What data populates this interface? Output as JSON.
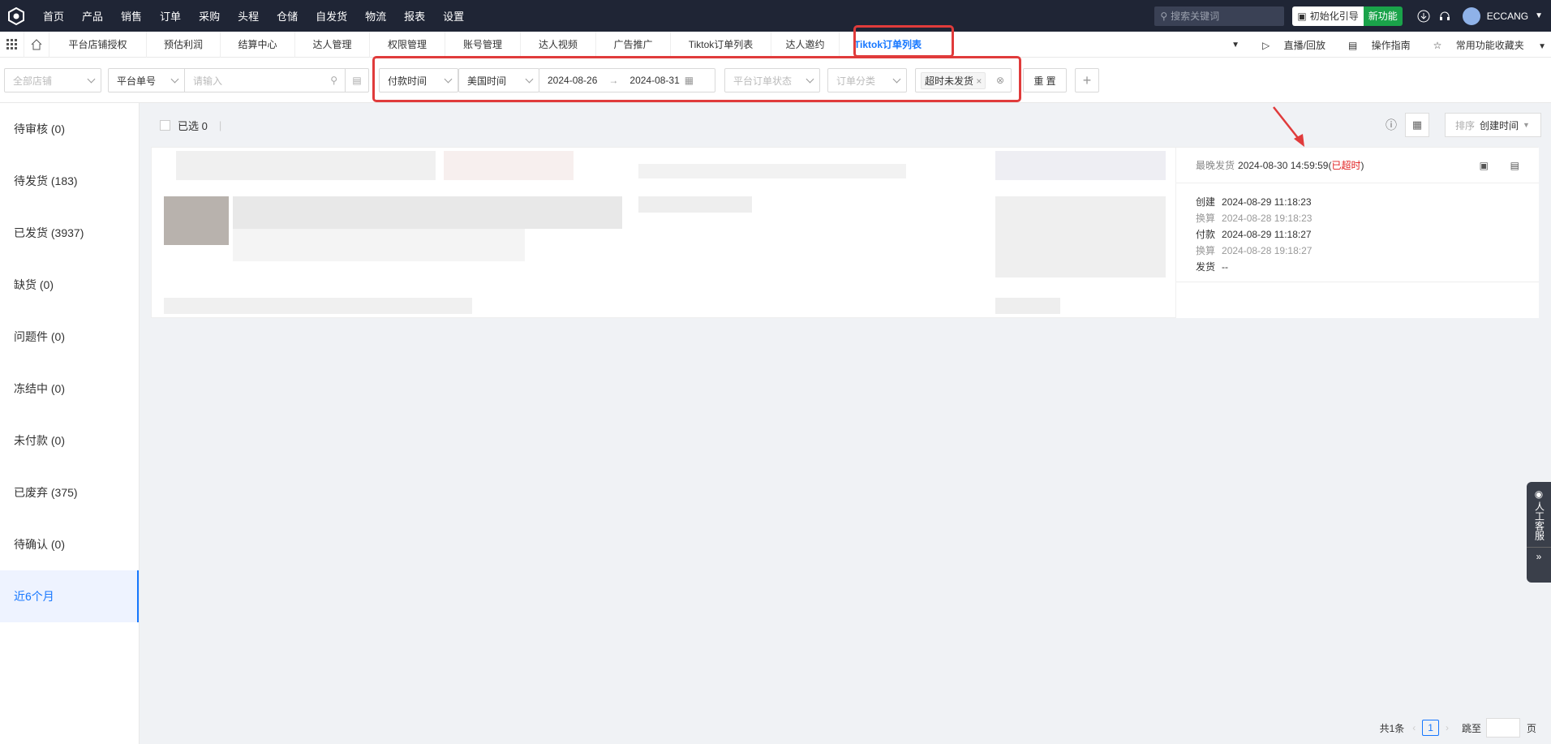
{
  "topnav": {
    "items": [
      "首页",
      "产品",
      "销售",
      "订单",
      "采购",
      "头程",
      "仓储",
      "自发货",
      "物流",
      "报表",
      "设置"
    ],
    "search_placeholder": "搜索关键词",
    "guide": "初始化引导",
    "new": "新功能",
    "user": "ECCANG"
  },
  "tabs": [
    "平台店铺授权",
    "预估利润",
    "结算中心",
    "达人管理",
    "权限管理",
    "账号管理",
    "达人视频",
    "广告推广",
    "Tiktok订单列表",
    "达人邀约",
    "Tiktok订单列表"
  ],
  "tabright": {
    "live": "直播/回放",
    "manual": "操作指南",
    "fav": "常用功能收藏夹"
  },
  "filters": {
    "store": "全部店铺",
    "order_type": "平台单号",
    "input_ph": "请输入",
    "time_type": "付款时间",
    "timezone": "美国时间",
    "date_start": "2024-08-26",
    "date_end": "2024-08-31",
    "status_ph": "平台订单状态",
    "category_ph": "订单分类",
    "tag": "超时未发货",
    "reset": "重 置",
    "add": "+"
  },
  "sidebar": [
    {
      "label": "待审核 (0)"
    },
    {
      "label": "待发货 (183)"
    },
    {
      "label": "已发货 (3937)"
    },
    {
      "label": "缺货 (0)"
    },
    {
      "label": "问题件 (0)"
    },
    {
      "label": "冻结中 (0)"
    },
    {
      "label": "未付款 (0)"
    },
    {
      "label": "已废弃 (375)"
    },
    {
      "label": "待确认 (0)"
    },
    {
      "label": "近6个月"
    }
  ],
  "selbar": {
    "selected": "已选 0",
    "sort_label": "排序",
    "sort_value": "创建时间"
  },
  "order": {
    "latest_ship_label": "最晚发货",
    "latest_ship": "2024-08-30 14:59:59",
    "overdue": "已超时",
    "create_label": "创建",
    "create": "2024-08-29 11:18:23",
    "conv1_label": "换算",
    "conv1": "2024-08-28 19:18:23",
    "pay_label": "付款",
    "pay": "2024-08-29 11:18:27",
    "conv2_label": "换算",
    "conv2": "2024-08-28 19:18:27",
    "ship_label": "发货",
    "ship": "--"
  },
  "pager": {
    "total": "共1条",
    "page": "1",
    "goto": "跳至",
    "page_unit": "页"
  },
  "float": {
    "label": "人工客服"
  }
}
